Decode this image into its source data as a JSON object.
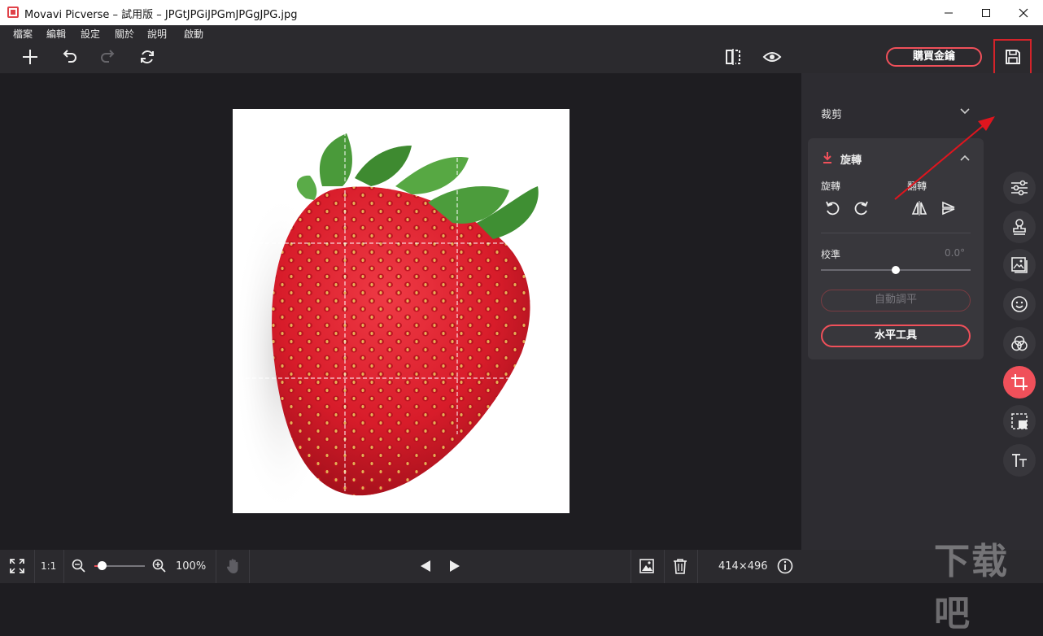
{
  "window": {
    "title": "Movavi Picverse – 試用版 – JPGtJPGiJPGmJPGgJPG.jpg"
  },
  "menu": [
    "檔案",
    "編輯",
    "設定",
    "關於",
    "說明",
    "啟動"
  ],
  "toolbar": {
    "buy_key_label": "購買金鑰"
  },
  "panel": {
    "crop_section": "裁剪",
    "rotate_section": "旋轉",
    "rotate_label": "旋轉",
    "flip_label": "翻轉",
    "calibrate_label": "校準",
    "calibrate_value": "0.0°",
    "calibrate_level": 0.5,
    "auto_level_label": "自動調平",
    "level_tool_label": "水平工具"
  },
  "bottom": {
    "ratio_label": "1:1",
    "zoom_value": "100%",
    "image_size": "414×496",
    "watermark": "下载吧"
  },
  "colors": {
    "accent": "#f0505a",
    "highlight_box": "#d4232a"
  }
}
